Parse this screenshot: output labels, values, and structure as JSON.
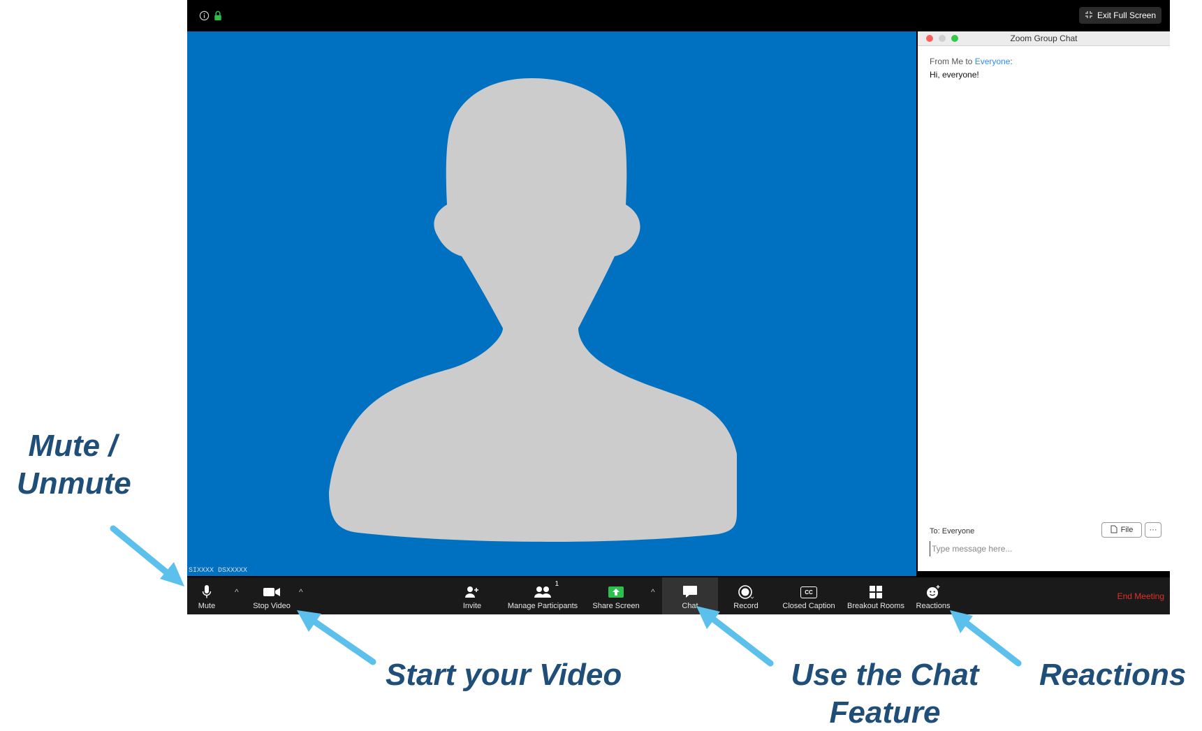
{
  "window": {
    "exit_full_screen_label": "Exit Full Screen",
    "participant_name": "SIXXXX DSXXXXX"
  },
  "chat": {
    "title": "Zoom Group Chat",
    "from_prefix": "From Me to ",
    "from_recipient": "Everyone",
    "from_suffix": ":",
    "message": "Hi, everyone!",
    "to_line": "To: Everyone",
    "file_label": "File",
    "more_label": "···",
    "input_placeholder": "Type message here..."
  },
  "toolbar": {
    "mute": "Mute",
    "stop_video": "Stop Video",
    "invite": "Invite",
    "manage_participants": "Manage Participants",
    "participant_count": "1",
    "share_screen": "Share Screen",
    "chat": "Chat",
    "record": "Record",
    "closed_caption": "Closed Caption",
    "cc_badge": "CC",
    "breakout_rooms": "Breakout Rooms",
    "reactions": "Reactions",
    "end_meeting": "End Meeting"
  },
  "annotations": {
    "mute_line1": "Mute /",
    "mute_line2": "Unmute",
    "video": "Start your Video",
    "chat_line1": "Use the Chat",
    "chat_line2": "Feature",
    "reactions": "Reactions"
  },
  "colors": {
    "video_background": "#0070c0",
    "silhouette": "#cccccc",
    "arrow": "#5bc0eb",
    "annotation_text": "#1f4e79",
    "end_meeting": "#e0312a",
    "share_screen_green": "#2ec04f"
  }
}
